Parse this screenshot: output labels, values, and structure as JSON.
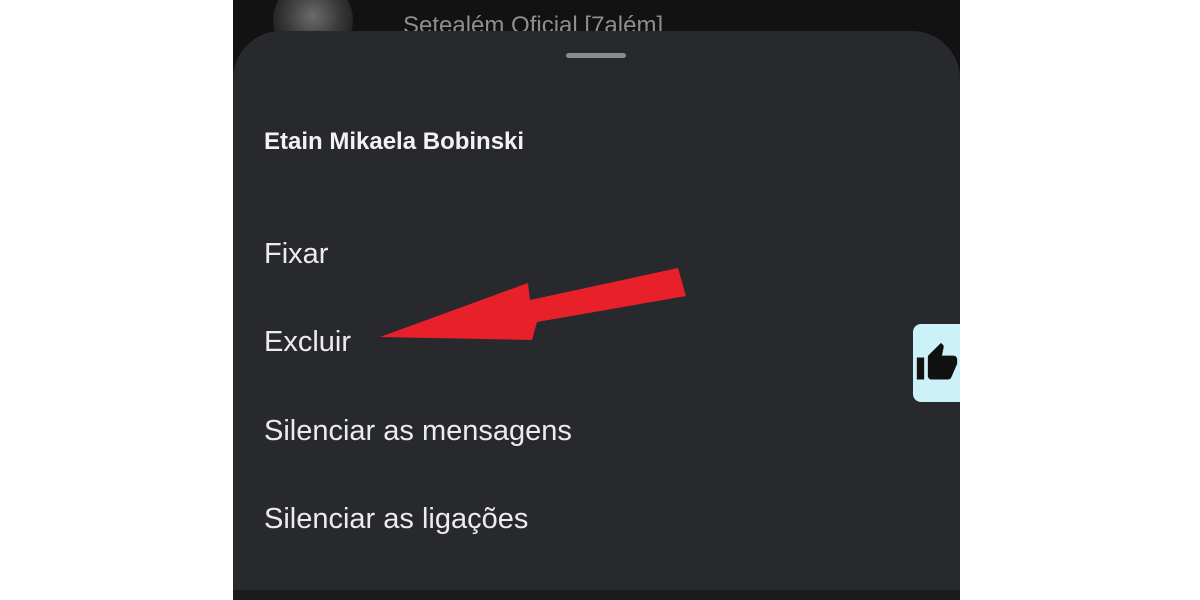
{
  "background_chat": {
    "title": "Setealém Oficial [7além]"
  },
  "sheet": {
    "title": "Etain Mikaela Bobinski",
    "items": [
      {
        "label": "Fixar"
      },
      {
        "label": "Excluir"
      },
      {
        "label": "Silenciar as mensagens"
      },
      {
        "label": "Silenciar as ligações"
      }
    ]
  },
  "side_button": {
    "icon": "thumbs-up-icon",
    "color": "#cdf1f8"
  },
  "annotation": {
    "type": "red-arrow",
    "points_to": "Excluir",
    "color": "#e8202a"
  },
  "colors": {
    "sheet_bg": "#27292c",
    "screen_bg": "#121212",
    "text": "#ececec"
  }
}
